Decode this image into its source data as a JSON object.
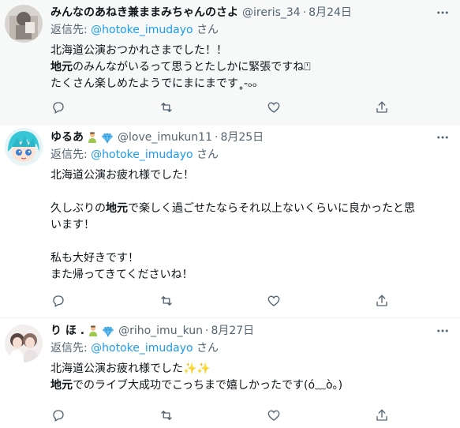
{
  "tweets": [
    {
      "display_name": "みんなのあねき兼ままみちゃんのさよ",
      "handle": "@ireris_34",
      "date": "8月24日",
      "replying_label": "返信先:",
      "replying_to": "@hotoke_imudayo",
      "replying_suffix": "さん",
      "line1": "北海道公演おつかれさまでした！！",
      "line2_bold": "地元",
      "line2_rest": "のみんながいるって思うとたしかに緊張ですね⍞",
      "line3": "たくさん楽しめたようでにまにまです˳-ₒₒ"
    },
    {
      "display_name": "ゆるあ",
      "handle": "@love_imukun11",
      "date": "8月25日",
      "replying_label": "返信先:",
      "replying_to": "@hotoke_imudayo",
      "replying_suffix": "さん",
      "line1": "北海道公演お疲れ様でした！",
      "line2_pre": "久しぶりの",
      "line2_bold": "地元",
      "line2_rest": "で楽しく過ごせたならそれ以上ないくらいに良かったと思",
      "line3": "います！",
      "line4": "私も大好きです！",
      "line5": "また帰ってきてくださいね！"
    },
    {
      "display_name": "り ほ .",
      "handle": "@riho_imu_kun",
      "date": "8月27日",
      "replying_label": "返信先:",
      "replying_to": "@hotoke_imudayo",
      "replying_suffix": "さん",
      "line1": "北海道公演お疲れ様でした",
      "line1_emoji": "✨✨",
      "line2_bold": "地元",
      "line2_rest": "でのライブ大成功でこっちまで嬉しかったです(ó﹏ò｡)"
    }
  ],
  "icons": [
    "more-icon",
    "reply-icon",
    "retweet-icon",
    "like-icon",
    "share-icon",
    "person-emoji-icon",
    "gem-emoji-icon"
  ],
  "colors": {
    "accent": "#1d9bf0",
    "secondary_text": "#536471",
    "hover_bg": "#f7f9f9",
    "divider": "#eff3f4"
  }
}
